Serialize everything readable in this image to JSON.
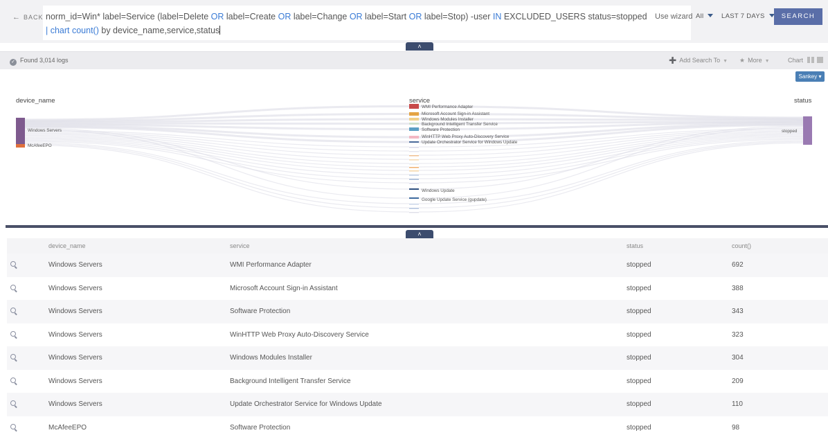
{
  "header": {
    "back_label": "BACK",
    "query_line1_a": "norm_id=Win* label=Service (label=Delete ",
    "query_or1": "OR",
    "query_line1_b": " label=Create ",
    "query_or2": "OR",
    "query_line1_c": " label=Change ",
    "query_or3": "OR",
    "query_line1_d": " label=Start ",
    "query_or4": "OR",
    "query_line1_e": " label=Stop) -user ",
    "query_in": "IN",
    "query_line1_f": " EXCLUDED_USERS status=stopped",
    "query_pipe_chart": "| chart count()",
    "query_line2": " by device_name,service,status",
    "use_wizard": "Use wizard",
    "repo_select": "All",
    "time_range": "LAST 7 DAYS",
    "search_button": "SEARCH",
    "collapse_glyph": "˄"
  },
  "toolbar": {
    "found_text": "Found 3,014 logs",
    "add_search_to": "Add Search To",
    "more": "More",
    "chart": "Chart",
    "sankey_select": "Sankey"
  },
  "chart_data": {
    "type": "sankey",
    "columns": [
      "device_name",
      "service",
      "status"
    ],
    "source_nodes": [
      {
        "label": "Windows Servers",
        "color": "#7e5a8e"
      },
      {
        "label": "McAfeeEPO",
        "color": "#e0703c"
      }
    ],
    "service_nodes": [
      {
        "label": "WMI Performance Adapter",
        "color": "#c84a4a"
      },
      {
        "label": "Microsoft Account Sign-in Assistant",
        "color": "#e4a444"
      },
      {
        "label": "Windows Modules Installer",
        "color": "#f2d08a"
      },
      {
        "label": "Background Intelligent Transfer Service",
        "color": "#cfe2cf"
      },
      {
        "label": "Software Protection",
        "color": "#5b9fc4"
      },
      {
        "label": "WinHTTP Web Proxy Auto-Discovery Service",
        "color": "#f2b8c4"
      },
      {
        "label": "Update Orchestrator Service for Windows Update",
        "color": "#4a6a9a"
      },
      {
        "label": "Windows Update",
        "color": "#2e4f80"
      },
      {
        "label": "Google Update Service (gupdate)",
        "color": "#3e6a9e"
      }
    ],
    "target_nodes": [
      {
        "label": "stopped",
        "color": "#9a7ab2"
      }
    ]
  },
  "table": {
    "headers": [
      "device_name",
      "service",
      "status",
      "count()"
    ],
    "rows": [
      [
        "Windows Servers",
        "WMI Performance Adapter",
        "stopped",
        "692"
      ],
      [
        "Windows Servers",
        "Microsoft Account Sign-in Assistant",
        "stopped",
        "388"
      ],
      [
        "Windows Servers",
        "Software Protection",
        "stopped",
        "343"
      ],
      [
        "Windows Servers",
        "WinHTTP Web Proxy Auto-Discovery Service",
        "stopped",
        "323"
      ],
      [
        "Windows Servers",
        "Windows Modules Installer",
        "stopped",
        "304"
      ],
      [
        "Windows Servers",
        "Background Intelligent Transfer Service",
        "stopped",
        "209"
      ],
      [
        "Windows Servers",
        "Update Orchestrator Service for Windows Update",
        "stopped",
        "110"
      ],
      [
        "McAfeeEPO",
        "Software Protection",
        "stopped",
        "98"
      ]
    ]
  }
}
